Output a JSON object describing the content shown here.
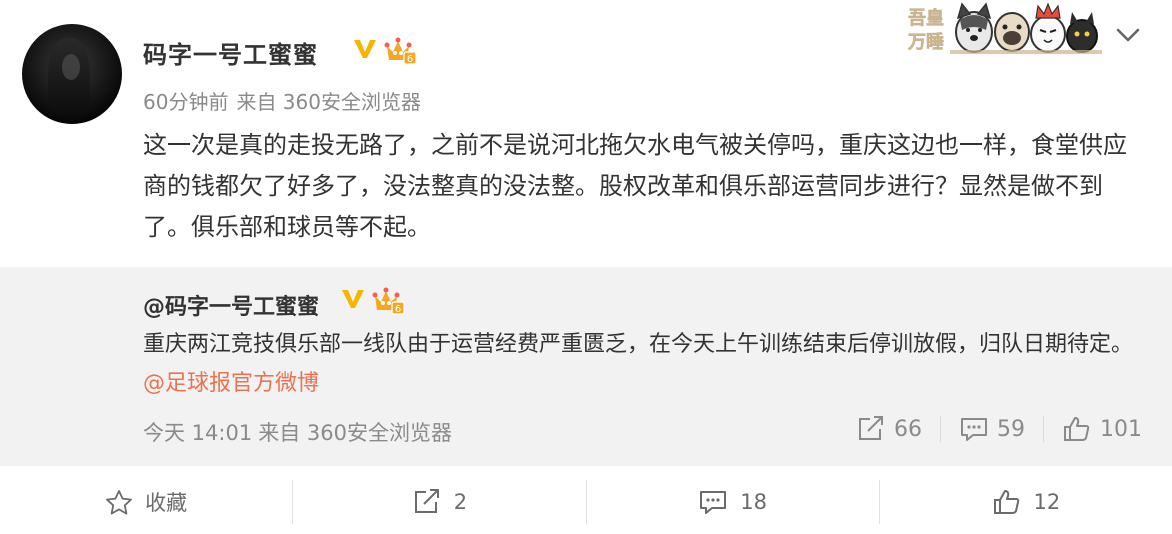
{
  "post": {
    "username": "码字一号工蜜蜜",
    "time": "60分钟前",
    "source": "来自 360安全浏览器",
    "text": "这一次是真的走投无路了，之前不是说河北拖欠水电气被关停吗，重庆这边也一样，食堂供应商的钱都欠了好多了，没法整真的没法整。股权改革和俱乐部运营同步进行？显然是做不到了。俱乐部和球员等不起。"
  },
  "badges": {
    "v_color": "#f7b500",
    "crown_level": "6"
  },
  "decor": {
    "logo_text": "吾皇万睡"
  },
  "repost": {
    "author": "@码字一号工蜜蜜",
    "text": "重庆两江竞技俱乐部一线队由于运营经费严重匮乏，在今天上午训练结束后停训放假，归队日期待定。",
    "mention": "@足球报官方微博",
    "time": "今天 14:01",
    "source": "来自 360安全浏览器",
    "reposts": "66",
    "comments": "59",
    "likes": "101"
  },
  "actions": {
    "favorite_label": "收藏",
    "repost_count": "2",
    "comment_count": "18",
    "like_count": "12"
  },
  "colors": {
    "mention": "#eb7350",
    "repost_bg": "#f2f2f2",
    "meta_text": "#8a8a8a"
  }
}
